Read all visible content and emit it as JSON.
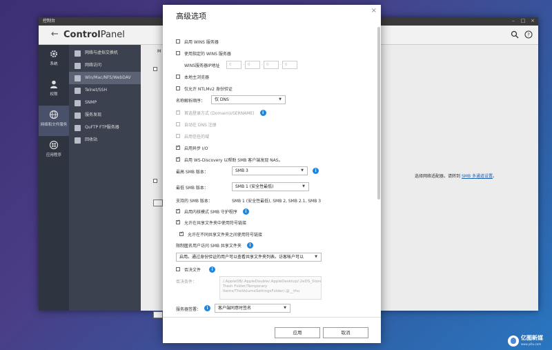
{
  "window": {
    "title": "控制台",
    "app_name_prefix": "Control",
    "app_name_suffix": "Panel"
  },
  "left_rail": [
    {
      "label": "系统",
      "icon": "gear-icon"
    },
    {
      "label": "权限",
      "icon": "user-icon"
    },
    {
      "label": "网络和文件服务",
      "icon": "globe-icon"
    },
    {
      "label": "应用程序",
      "icon": "apps-icon"
    }
  ],
  "nav": [
    {
      "label": "网络与虚拟交换机"
    },
    {
      "label": "网络访问"
    },
    {
      "label": "Win/Mac/NFS/WebDAV"
    },
    {
      "label": "Telnet/SSH"
    },
    {
      "label": "SNMP"
    },
    {
      "label": "服务发现"
    },
    {
      "label": "QuFTP FTP服务器"
    },
    {
      "label": "回收站"
    }
  ],
  "main": {
    "tab_label": "M",
    "hint_text": "选择网络适配器，请转到",
    "hint_link": "SMB 多通道设置",
    "hint_end": "。"
  },
  "dialog": {
    "title": "高级选项",
    "close": "×",
    "wins_server": "启用 WINS 服务器",
    "use_wins": "使用指定的 WINS 服务器",
    "wins_ip_label": "WINS服务器IP地址",
    "ip": [
      "0",
      "0",
      "0",
      "0"
    ],
    "local_master": "本地主浏览器",
    "ntlmv2": "仅允许 NTLMv2 身份验证",
    "name_resolution_label": "名称解析顺序：",
    "name_resolution_value": "仅 DNS",
    "login_style": "首选登录方式 (Domain\\USERNAME)",
    "dns_register": "自动在 DNS 注册",
    "trusted_domain": "启用信任的域",
    "async_io": "启用异步 I/O",
    "ws_discovery": "启用 WS-Discovery 以帮助 SMB 客户端发现 NAS。",
    "max_smb_label": "最高 SMB 版本：",
    "max_smb_value": "SMB 3",
    "min_smb_label": "最低 SMB 版本：",
    "min_smb_value": "SMB 1 (安全性最低)",
    "supported_label": "支持的 SMB 版本：",
    "supported_value": "SMB 1 (安全性最低), SMB 2, SMB 2.1, SMB 3",
    "kernel_smb": "启用内核模式 SMB 守护程序",
    "symlink_in_share": "允许在共享文件夹中使用符号链接",
    "symlink_across": "允许在不同共享文件夹之间使用符号链接",
    "anon_label": "限制匿名用户访问 SMB 共享文件夹",
    "anon_value": "启用。通过身份验证的用户可以查看共享文件夹列表。访客帐户可以",
    "veto_files": "否决文件",
    "veto_label": "否决条件：",
    "veto_text": "/.AppleDB/.AppleDouble/.AppleDesktop/:2eDS_Store/Network Trash Folder/Temporary Items/TheVolumeSettingsFolder/.@__thu",
    "server_signing_label": "服务器签署：",
    "server_signing_value": "客户端同意时签名",
    "apply": "应用",
    "cancel": "取消"
  },
  "watermark": {
    "name": "亿图新媒",
    "url": "www.yiitu.com"
  }
}
